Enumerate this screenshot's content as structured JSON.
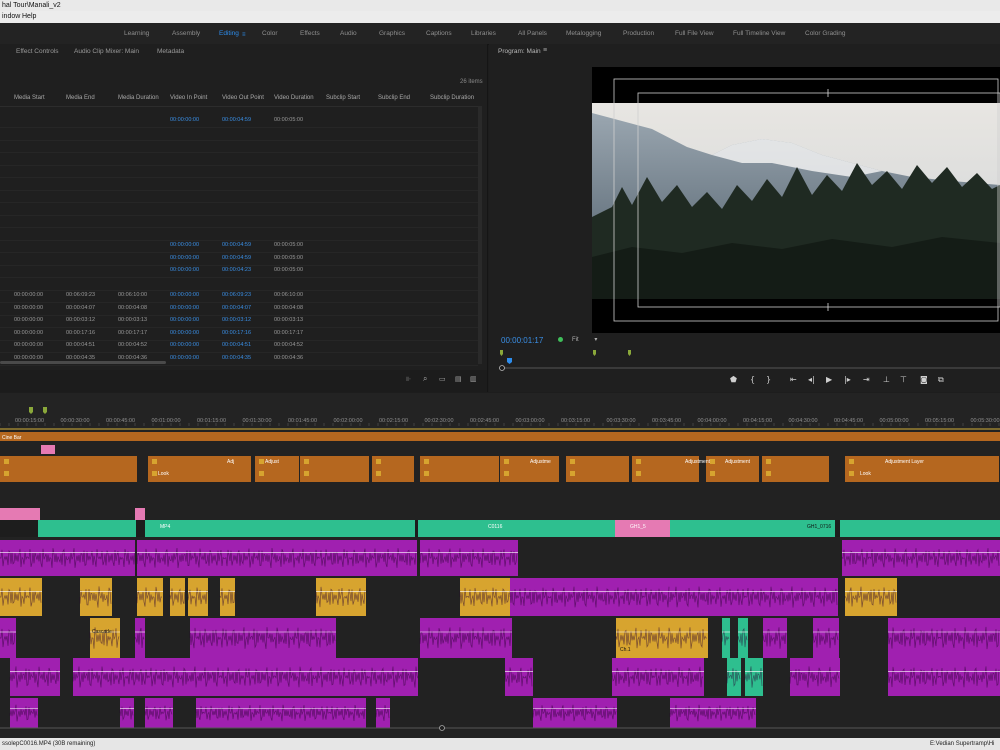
{
  "window": {
    "title": "hal Tour\\Manali_v2"
  },
  "menu": {
    "items": [
      "indow",
      "Help"
    ]
  },
  "workspaces": {
    "items": [
      "Learning",
      "Assembly",
      "Editing",
      "Color",
      "Effects",
      "Audio",
      "Graphics",
      "Captions",
      "Libraries",
      "All Panels",
      "Metalogging",
      "Production",
      "Full File View",
      "Full Timeline View",
      "Color Grading"
    ],
    "active": "Editing"
  },
  "left_panel": {
    "tabs": [
      "Effect Controls",
      "Audio Clip Mixer: Main",
      "Metadata"
    ],
    "items_count": "26 items",
    "columns": [
      "Media Start",
      "Media End",
      "Media Duration",
      "Video In Point",
      "Video Out Point",
      "Video Duration",
      "Subclip Start",
      "Subclip End",
      "Subclip Duration"
    ],
    "rows": [
      [
        "",
        "",
        "",
        "00:00:00:00",
        "00:00:04:59",
        "00:00:05:00"
      ],
      [
        "",
        "",
        "",
        "",
        "",
        ""
      ],
      [
        "",
        "",
        "",
        "",
        "",
        ""
      ],
      [
        "",
        "",
        "",
        "",
        "",
        ""
      ],
      [
        "",
        "",
        "",
        "",
        "",
        ""
      ],
      [
        "",
        "",
        "",
        "",
        "",
        ""
      ],
      [
        "",
        "",
        "",
        "",
        "",
        ""
      ],
      [
        "",
        "",
        "",
        "",
        "",
        ""
      ],
      [
        "",
        "",
        "",
        "",
        "",
        ""
      ],
      [
        "",
        "",
        "",
        "",
        "",
        ""
      ],
      [
        "",
        "",
        "",
        "00:00:00:00",
        "00:00:04:59",
        "00:00:05:00"
      ],
      [
        "",
        "",
        "",
        "00:00:00:00",
        "00:00:04:59",
        "00:00:05:00"
      ],
      [
        "",
        "",
        "",
        "00:00:00:00",
        "00:00:04:23",
        "00:00:05:00"
      ],
      [
        "",
        "",
        "",
        "",
        "",
        ""
      ],
      [
        "00:00:00:00",
        "00:06:09:23",
        "00:06:10:00",
        "00:00:00:00",
        "00:06:09:23",
        "00:06:10:00"
      ],
      [
        "00:00:00:00",
        "00:00:04:07",
        "00:00:04:08",
        "00:00:00:00",
        "00:00:04:07",
        "00:00:04:08"
      ],
      [
        "00:00:00:00",
        "00:00:03:12",
        "00:00:03:13",
        "00:00:00:00",
        "00:00:03:12",
        "00:00:03:13"
      ],
      [
        "00:00:00:00",
        "00:00:17:16",
        "00:00:17:17",
        "00:00:00:00",
        "00:00:17:16",
        "00:00:17:17"
      ],
      [
        "00:00:00:00",
        "00:00:04:51",
        "00:00:04:52",
        "00:00:00:00",
        "00:00:04:51",
        "00:00:04:52"
      ],
      [
        "00:00:00:00",
        "00:00:04:35",
        "00:00:04:36",
        "00:00:00:00",
        "00:00:04:35",
        "00:00:04:36"
      ]
    ]
  },
  "program": {
    "title": "Program: Main",
    "timecode": "00:00:01:17",
    "zoom": "Fit"
  },
  "timeline": {
    "ruler": [
      "00:00:15:00",
      "00:00:30:00",
      "00:00:45:00",
      "00:01:00:00",
      "00:01:15:00",
      "00:01:30:00",
      "00:01:45:00",
      "00:02:00:00",
      "00:02:15:00",
      "00:02:30:00",
      "00:02:45:00",
      "00:03:00:00",
      "00:03:15:00",
      "00:03:30:00",
      "00:03:45:00",
      "00:04:00:00",
      "00:04:15:00",
      "00:04:30:00",
      "00:04:45:00",
      "00:05:00:00",
      "00:05:15:00",
      "00:05:30:00"
    ],
    "clip_labels": {
      "top_bar": "Cine Bar",
      "adjustment": [
        "Adj",
        "Adjust",
        "Adjustm",
        "Adjustm",
        "Adjustm",
        "Adjustm",
        "Adjustme",
        "Adjustment",
        "Adjustment",
        "Adjustment Layer",
        "Adjust",
        "Adjust"
      ],
      "look": "Look",
      "video1": [
        "MP4",
        "C0116",
        "GH1_5",
        "GH1_0716"
      ],
      "audio": [
        "Cascade",
        "Ch.1"
      ]
    },
    "colors": {
      "orange": "#b5671f",
      "teal": "#2ebf8f",
      "pink": "#e57ab3",
      "purple": "#a020b0",
      "yellow": "#d7a42f",
      "gray": "#5a5a5a"
    }
  },
  "status": {
    "left": "ssolepC0016.MP4 (30B remaining)",
    "right": "E:Vedian Supertramp\\Hi"
  }
}
